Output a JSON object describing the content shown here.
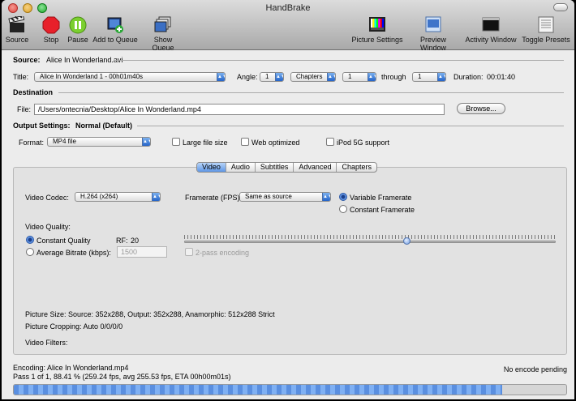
{
  "window": {
    "title": "HandBrake"
  },
  "toolbar": {
    "source": "Source",
    "stop": "Stop",
    "pause": "Pause",
    "add_to_queue": "Add to Queue",
    "show_queue": "Show Queue",
    "picture_settings": "Picture Settings",
    "preview_window": "Preview Window",
    "activity_window": "Activity Window",
    "toggle_presets": "Toggle Presets"
  },
  "source": {
    "label": "Source:",
    "value": "Alice In Wonderland.avi"
  },
  "title_row": {
    "title_label": "Title:",
    "title_value": "Alice In Wonderland 1 - 00h01m40s",
    "angle_label": "Angle:",
    "angle_value": "1",
    "range_value": "Chapters",
    "start_value": "1",
    "through_label": "through",
    "end_value": "1",
    "duration_label": "Duration:",
    "duration_value": "00:01:40"
  },
  "destination": {
    "header": "Destination",
    "file_label": "File:",
    "file_value": "/Users/ontecnia/Desktop/Alice In Wonderland.mp4",
    "browse_label": "Browse..."
  },
  "output": {
    "header_label": "Output Settings:",
    "preset_name": "Normal (Default)",
    "format_label": "Format:",
    "format_value": "MP4 file",
    "large_file": "Large file size",
    "web_optimized": "Web optimized",
    "ipod": "iPod 5G support"
  },
  "tabs": [
    "Video",
    "Audio",
    "Subtitles",
    "Advanced",
    "Chapters"
  ],
  "video": {
    "codec_label": "Video Codec:",
    "codec_value": "H.264 (x264)",
    "framerate_label": "Framerate (FPS):",
    "framerate_value": "Same as source",
    "variable_framerate": "Variable Framerate",
    "constant_framerate": "Constant Framerate",
    "quality_label": "Video Quality:",
    "constant_quality": "Constant Quality",
    "rf_label": "RF:",
    "rf_value": "20",
    "average_bitrate": "Average Bitrate (kbps):",
    "bitrate_placeholder": "1500",
    "two_pass": "2-pass encoding",
    "quality_slider_fraction": 0.6
  },
  "info": {
    "picture_size": "Picture Size: Source: 352x288, Output: 352x288, Anamorphic: 512x288 Strict",
    "picture_cropping": "Picture Cropping: Auto 0/0/0/0",
    "video_filters": "Video Filters:"
  },
  "status": {
    "encoding": "Encoding: Alice In Wonderland.mp4",
    "pass_info": "Pass 1  of 1, 88.41 % (259.24 fps, avg 255.53 fps, ETA 00h00m01s)",
    "queue_status": "No encode pending",
    "progress_percent": 88.41
  },
  "colors": {
    "close": "#e0443e",
    "minimize": "#dea123",
    "zoom": "#1aab29",
    "accent": "#3d76d4"
  }
}
